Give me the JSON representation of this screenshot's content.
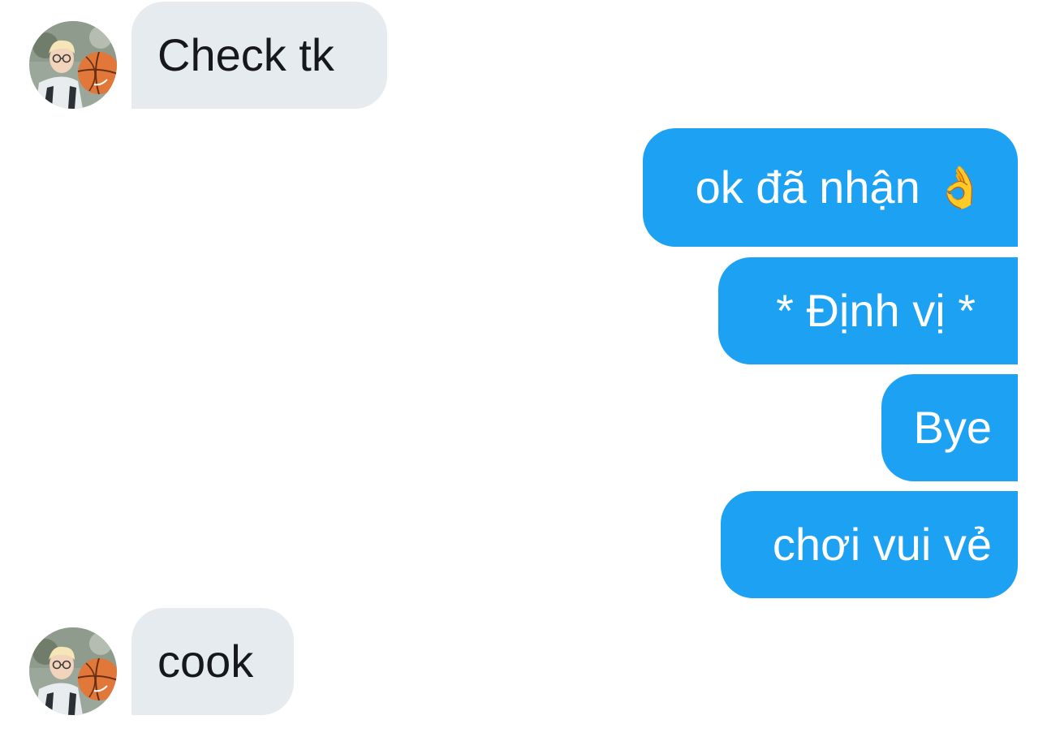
{
  "conversation": {
    "messages": [
      {
        "direction": "incoming",
        "text": "Check tk"
      },
      {
        "direction": "outgoing",
        "text": "ok đã nhận",
        "emoji": "👌"
      },
      {
        "direction": "outgoing",
        "text": "* Định vị *"
      },
      {
        "direction": "outgoing",
        "text": "Bye"
      },
      {
        "direction": "outgoing",
        "text": "chơi vui vẻ"
      },
      {
        "direction": "incoming",
        "text": "cook"
      }
    ]
  },
  "avatar_icon": "user-avatar-photo",
  "colors": {
    "incoming_bubble": "#e6ebef",
    "outgoing_bubble": "#1da1f2",
    "incoming_text": "#16181c",
    "outgoing_text": "#ffffff"
  }
}
